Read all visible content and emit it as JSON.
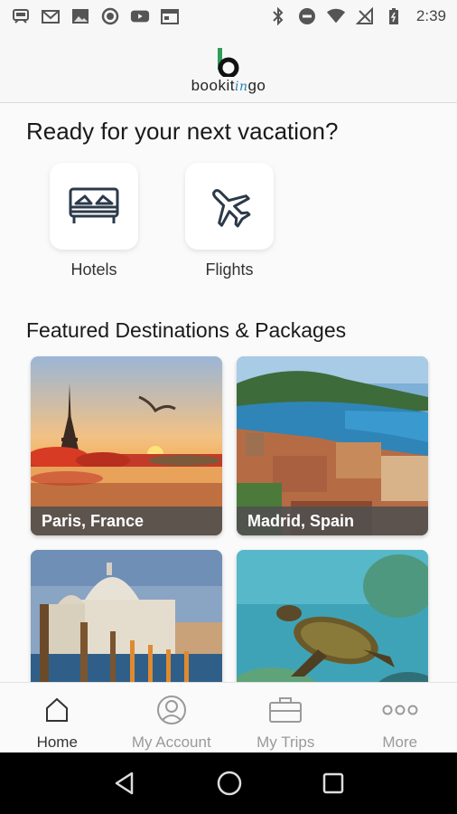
{
  "status_bar": {
    "time": "2:39",
    "icons_left": [
      "train-icon",
      "gmail-icon",
      "image-icon",
      "circle-icon",
      "youtube-icon",
      "calendar-icon"
    ],
    "icons_right": [
      "bluetooth-icon",
      "do-not-disturb-icon",
      "wifi-icon",
      "no-signal-icon",
      "battery-icon"
    ]
  },
  "header": {
    "logo_text_left": "bookit",
    "logo_text_mid": "in",
    "logo_text_right": "go",
    "brand_color": "#2e9e5b"
  },
  "main": {
    "headline": "Ready for your next vacation?",
    "categories": [
      {
        "label": "Hotels",
        "icon": "bed-icon"
      },
      {
        "label": "Flights",
        "icon": "airplane-icon"
      }
    ],
    "section_title": "Featured Destinations & Packages",
    "destinations": [
      {
        "label": "Paris, France"
      },
      {
        "label": "Madrid, Spain"
      },
      {
        "label": ""
      },
      {
        "label": ""
      }
    ]
  },
  "bottom_nav": {
    "items": [
      {
        "label": "Home",
        "icon": "home-icon",
        "active": true
      },
      {
        "label": "My Account",
        "icon": "account-icon",
        "active": false
      },
      {
        "label": "My Trips",
        "icon": "briefcase-icon",
        "active": false
      },
      {
        "label": "More",
        "icon": "more-icon",
        "active": false
      }
    ]
  },
  "system_nav": {
    "icons": [
      "back-icon",
      "home-circle-icon",
      "recents-icon"
    ]
  }
}
